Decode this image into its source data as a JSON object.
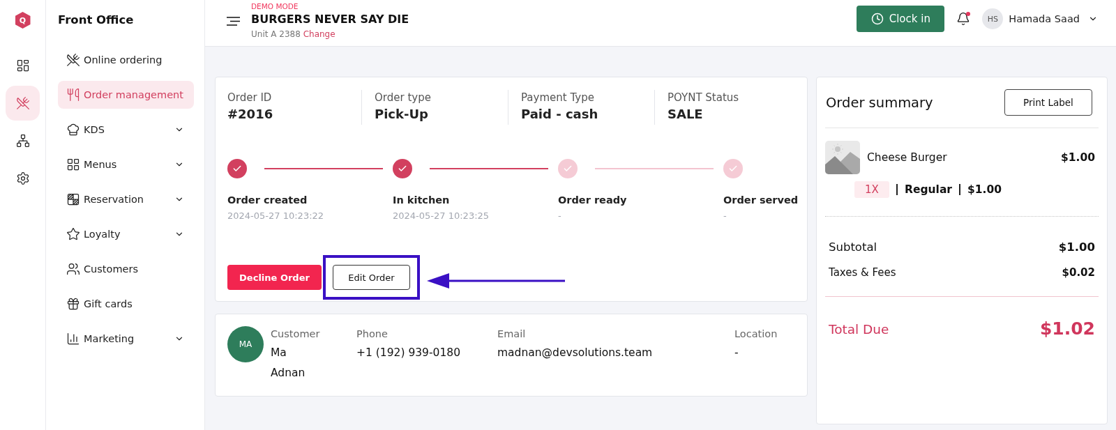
{
  "app_logo": {
    "letter": "Q"
  },
  "rail": [
    {
      "kind": "dashboard",
      "selected": false
    },
    {
      "kind": "dining",
      "selected": true
    },
    {
      "kind": "network",
      "selected": false
    },
    {
      "kind": "settings",
      "selected": false
    }
  ],
  "sidebar": {
    "title": "Front Office",
    "items": [
      {
        "label": "Online ordering",
        "kind": "dining",
        "selected": false,
        "has_submenu": false
      },
      {
        "label": "Order management",
        "kind": "cutlery",
        "selected": true,
        "has_submenu": false
      },
      {
        "label": "KDS",
        "kind": "chef",
        "selected": false,
        "has_submenu": true
      },
      {
        "label": "Menus",
        "kind": "grid",
        "selected": false,
        "has_submenu": true
      },
      {
        "label": "Reservation",
        "kind": "table",
        "selected": false,
        "has_submenu": true
      },
      {
        "label": "Loyalty",
        "kind": "star",
        "selected": false,
        "has_submenu": true
      },
      {
        "label": "Customers",
        "kind": "users",
        "selected": false,
        "has_submenu": false
      },
      {
        "label": "Gift cards",
        "kind": "gift",
        "selected": false,
        "has_submenu": false
      },
      {
        "label": "Marketing",
        "kind": "chart",
        "selected": false,
        "has_submenu": true
      }
    ]
  },
  "header": {
    "mode": "DEMO MODE",
    "business": "BURGERS NEVER SAY DIE",
    "unit": "Unit A 2388",
    "change_link": "Change",
    "clock_in": "Clock in",
    "has_unread": true,
    "user": {
      "initials": "HS",
      "name": "Hamada Saad"
    }
  },
  "order": {
    "info": [
      {
        "label": "Order ID",
        "value": "#2016"
      },
      {
        "label": "Order type",
        "value": "Pick-Up"
      },
      {
        "label": "Payment Type",
        "value": "Paid - cash"
      },
      {
        "label": "POYNT Status",
        "value": "SALE"
      }
    ],
    "steps": [
      {
        "label": "Order created",
        "time": "2024-05-27 10:23:22",
        "done": true
      },
      {
        "label": "In kitchen",
        "time": "2024-05-27 10:23:25",
        "done": true
      },
      {
        "label": "Order ready",
        "time": "-",
        "done": false
      },
      {
        "label": "Order served",
        "time": "-",
        "done": false
      }
    ],
    "actions": [
      {
        "kind": "decline",
        "label": "Decline Order",
        "highlighted": false
      },
      {
        "kind": "edit",
        "label": "Edit Order",
        "highlighted": true
      }
    ]
  },
  "customer": {
    "initials": "MA",
    "fields": [
      {
        "label": "Customer",
        "value": "Ma Adnan"
      },
      {
        "label": "Phone",
        "value": "+1 (192) 939-0180"
      },
      {
        "label": "Email",
        "value": "madnan@devsolutions.team"
      },
      {
        "label": "Location",
        "value": "-"
      }
    ]
  },
  "summary": {
    "title": "Order summary",
    "print_button": "Print Label",
    "items": [
      {
        "name": "Cheese Burger",
        "price": "$1.00",
        "quantity": "1X",
        "variant": "Regular",
        "variant_price": "$1.00"
      }
    ],
    "totals": [
      {
        "label": "Subtotal",
        "value": "$1.00"
      },
      {
        "label": "Taxes & Fees",
        "value": "$0.02"
      }
    ],
    "total": {
      "label": "Total Due",
      "value": "$1.02"
    }
  }
}
